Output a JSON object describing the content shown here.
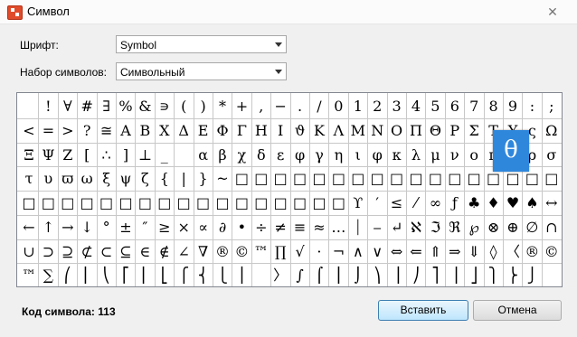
{
  "window": {
    "title": "Символ",
    "close": "✕"
  },
  "font_label": "Шрифт:",
  "font_value": "Symbol",
  "charset_label": "Набор символов:",
  "charset_value": "Символьный",
  "grid": {
    "rows": [
      [
        " ",
        "!",
        "∀",
        "#",
        "∃",
        "%",
        "&",
        "∍",
        "(",
        ")",
        "*",
        "+",
        ",",
        "−",
        ".",
        "/",
        "0",
        "1",
        "2",
        "3",
        "4",
        "5",
        "6",
        "7",
        "8",
        "9",
        ":",
        ";"
      ],
      [
        "<",
        "=",
        ">",
        "?",
        "≅",
        "Α",
        "Β",
        "Χ",
        "Δ",
        "Ε",
        "Φ",
        "Γ",
        "Η",
        "Ι",
        "ϑ",
        "Κ",
        "Λ",
        "Μ",
        "Ν",
        "Ο",
        "Π",
        "Θ",
        "Ρ",
        "Σ",
        "Τ",
        "Υ",
        "ς",
        "Ω"
      ],
      [
        "Ξ",
        "Ψ",
        "Ζ",
        "[",
        "∴",
        "]",
        "⊥",
        "_",
        "",
        "α",
        "β",
        "χ",
        "δ",
        "ε",
        "φ",
        "γ",
        "η",
        "ι",
        "φ",
        "κ",
        "λ",
        "μ",
        "ν",
        "ο",
        "π",
        "θ",
        "ρ",
        "σ"
      ],
      [
        "τ",
        "υ",
        "ϖ",
        "ω",
        "ξ",
        "ψ",
        "ζ",
        "{",
        "|",
        "}",
        "~",
        "□",
        "□",
        "□",
        "□",
        "□",
        "□",
        "□",
        "□",
        "□",
        "□",
        "□",
        "□",
        "□",
        "□",
        "□",
        "□",
        "□"
      ],
      [
        "□",
        "□",
        "□",
        "□",
        "□",
        "□",
        "□",
        "□",
        "□",
        "□",
        "□",
        "□",
        "□",
        "□",
        "□",
        "□",
        "□",
        "ϒ",
        "′",
        "≤",
        "⁄",
        "∞",
        "ƒ",
        "♣",
        "♦",
        "♥",
        "♠",
        "↔"
      ],
      [
        "←",
        "↑",
        "→",
        "↓",
        "°",
        "±",
        "″",
        "≥",
        "×",
        "∝",
        "∂",
        "•",
        "÷",
        "≠",
        "≡",
        "≈",
        "…",
        "⏐",
        "⎯",
        "↵",
        "ℵ",
        "ℑ",
        "ℜ",
        "℘",
        "⊗",
        "⊕",
        "∅",
        "∩"
      ],
      [
        "∪",
        "⊃",
        "⊇",
        "⊄",
        "⊂",
        "⊆",
        "∈",
        "∉",
        "∠",
        "∇",
        "®",
        "©",
        "™",
        "∏",
        "√",
        "⋅",
        "¬",
        "∧",
        "∨",
        "⇔",
        "⇐",
        "⇑",
        "⇒",
        "⇓",
        "◊",
        "〈",
        "®",
        "©"
      ],
      [
        "™",
        "∑",
        "⎛",
        "⎜",
        "⎝",
        "⎡",
        "⎢",
        "⎣",
        "⎧",
        "⎨",
        "⎩",
        "⎪",
        "",
        "〉",
        "∫",
        "⌠",
        "⎮",
        "⌡",
        "⎞",
        "⎟",
        "⎠",
        "⎤",
        "⎥",
        "⎦",
        "⎫",
        "⎬",
        "⎭",
        ""
      ]
    ]
  },
  "selected_char": "θ",
  "char_code_label": "Код символа: 113",
  "insert_label": "Вставить",
  "cancel_label": "Отмена"
}
